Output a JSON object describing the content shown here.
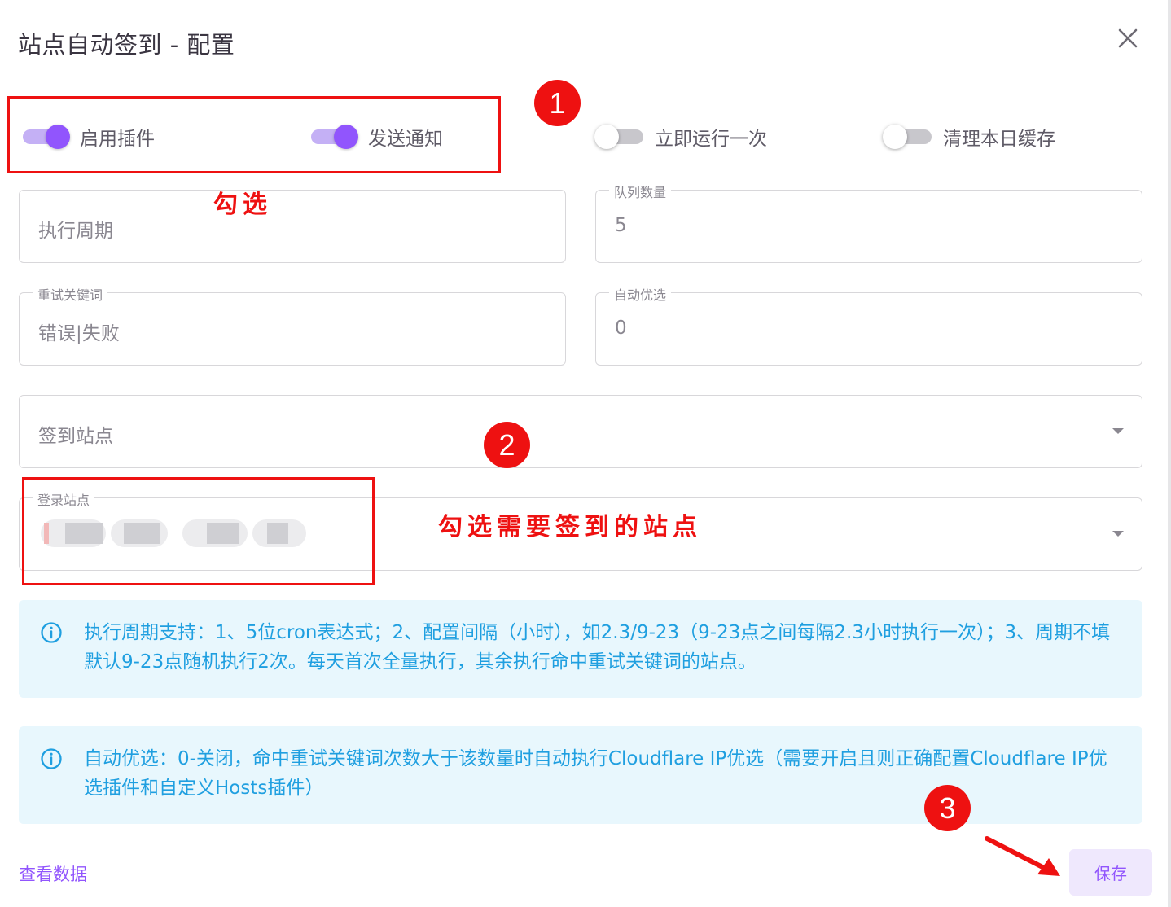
{
  "dialog": {
    "title": "站点自动签到 - 配置"
  },
  "switches": [
    {
      "label": "启用插件",
      "on": true
    },
    {
      "label": "发送通知",
      "on": true
    },
    {
      "label": "立即运行一次",
      "on": false
    },
    {
      "label": "清理本日缓存",
      "on": false
    }
  ],
  "fields": {
    "cron": {
      "placeholder": "执行周期"
    },
    "queue": {
      "label": "队列数量",
      "value": "5"
    },
    "retry_keywords": {
      "label": "重试关键词",
      "value": "错误|失败"
    },
    "auto_optimize": {
      "label": "自动优选",
      "value": "0"
    },
    "sign_sites": {
      "placeholder": "签到站点"
    },
    "login_sites": {
      "label": "登录站点"
    }
  },
  "alerts": [
    {
      "icon": "info-icon",
      "text": "执行周期支持：1、5位cron表达式；2、配置间隔（小时），如2.3/9-23（9-23点之间每隔2.3小时执行一次）；3、周期不填默认9-23点随机执行2次。每天首次全量执行，其余执行命中重试关键词的站点。"
    },
    {
      "icon": "info-icon",
      "text": "自动优选：0-关闭，命中重试关键词次数大于该数量时自动执行Cloudflare IP优选（需要开启且则正确配置Cloudflare IP优选插件和自定义Hosts插件）"
    }
  ],
  "footer": {
    "view_data": "查看数据",
    "save": "保存"
  },
  "annotations": {
    "badge1": "1",
    "badge2": "2",
    "badge3": "3",
    "check_note": "勾选",
    "sites_note": "勾选需要签到的站点",
    "color": "#ee1111"
  },
  "colors": {
    "primary": "#9155fd",
    "info": "#1f9fe0",
    "info_bg": "#e8f7fd"
  }
}
